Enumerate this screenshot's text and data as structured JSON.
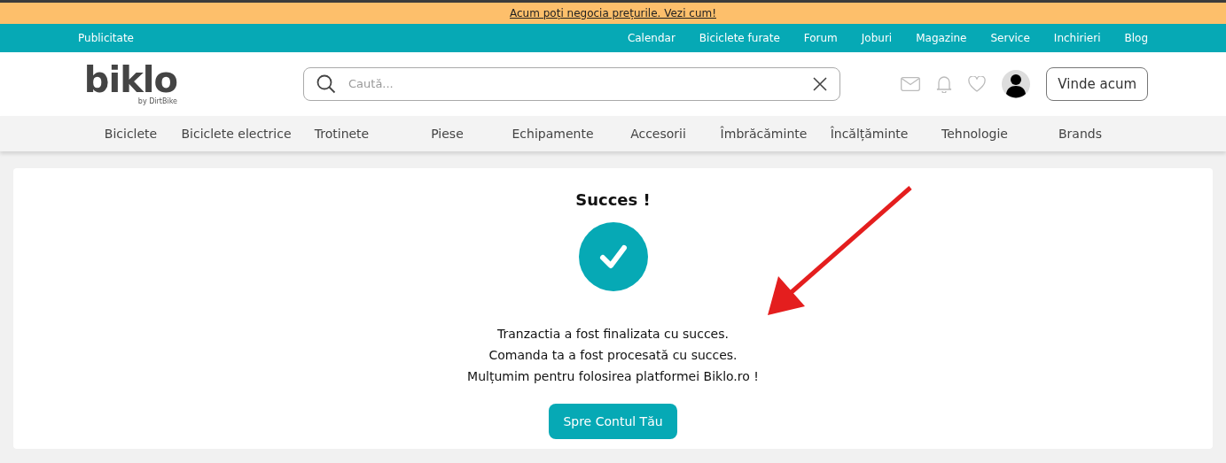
{
  "promo_banner": {
    "text": "Acum poți negocia prețurile. Vezi cum!"
  },
  "top_bar": {
    "left_link": "Publicitate",
    "links": [
      "Calendar",
      "Biciclete furate",
      "Forum",
      "Joburi",
      "Magazine",
      "Service",
      "Inchirieri",
      "Blog"
    ]
  },
  "header": {
    "logo": {
      "name": "biklo",
      "tagline": "by DirtBike"
    },
    "search": {
      "placeholder": "Caută..."
    },
    "sell_button": "Vinde acum"
  },
  "categories": [
    "Biciclete",
    "Biciclete electrice",
    "Trotinete",
    "Piese",
    "Echipamente",
    "Accesorii",
    "Îmbrăcăminte",
    "Încălțăminte",
    "Tehnologie",
    "Brands"
  ],
  "success_card": {
    "title": "Succes !",
    "messages": [
      "Tranzactia a fost finalizata cu succes.",
      "Comanda ta a fost procesată cu succes.",
      "Mulțumim pentru folosirea platformei Biklo.ro !"
    ],
    "button": "Spre Contul Tău"
  }
}
